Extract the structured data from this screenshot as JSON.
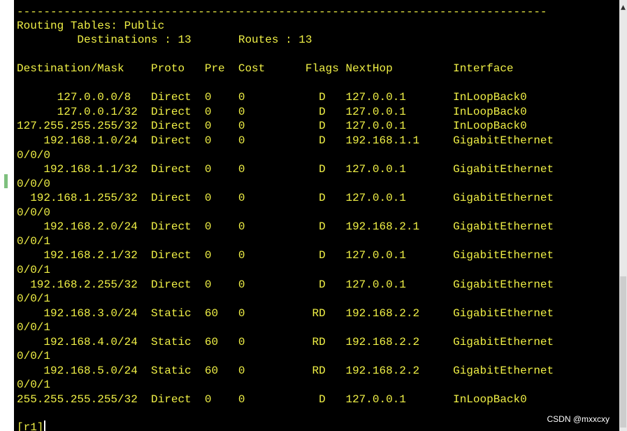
{
  "terminal": {
    "lines": [
      "-------------------------------------------------------------------------------",
      "Routing Tables: Public",
      "         Destinations : 13       Routes : 13",
      "",
      "Destination/Mask    Proto   Pre  Cost      Flags NextHop         Interface",
      "",
      "      127.0.0.0/8   Direct  0    0           D   127.0.0.1       InLoopBack0",
      "      127.0.0.1/32  Direct  0    0           D   127.0.0.1       InLoopBack0",
      "127.255.255.255/32  Direct  0    0           D   127.0.0.1       InLoopBack0",
      "    192.168.1.0/24  Direct  0    0           D   192.168.1.1     GigabitEthernet",
      "0/0/0",
      "    192.168.1.1/32  Direct  0    0           D   127.0.0.1       GigabitEthernet",
      "0/0/0",
      "  192.168.1.255/32  Direct  0    0           D   127.0.0.1       GigabitEthernet",
      "0/0/0",
      "    192.168.2.0/24  Direct  0    0           D   192.168.2.1     GigabitEthernet",
      "0/0/1",
      "    192.168.2.1/32  Direct  0    0           D   127.0.0.1       GigabitEthernet",
      "0/0/1",
      "  192.168.2.255/32  Direct  0    0           D   127.0.0.1       GigabitEthernet",
      "0/0/1",
      "    192.168.3.0/24  Static  60   0          RD   192.168.2.2     GigabitEthernet",
      "0/0/1",
      "    192.168.4.0/24  Static  60   0          RD   192.168.2.2     GigabitEthernet",
      "0/0/1",
      "    192.168.5.0/24  Static  60   0          RD   192.168.2.2     GigabitEthernet",
      "0/0/1",
      "255.255.255.255/32  Direct  0    0           D   127.0.0.1       InLoopBack0"
    ],
    "prompt": "[r1]"
  },
  "watermark": "CSDN @mxxcxy",
  "colors": {
    "text": "#f0f046",
    "background": "#000000"
  }
}
